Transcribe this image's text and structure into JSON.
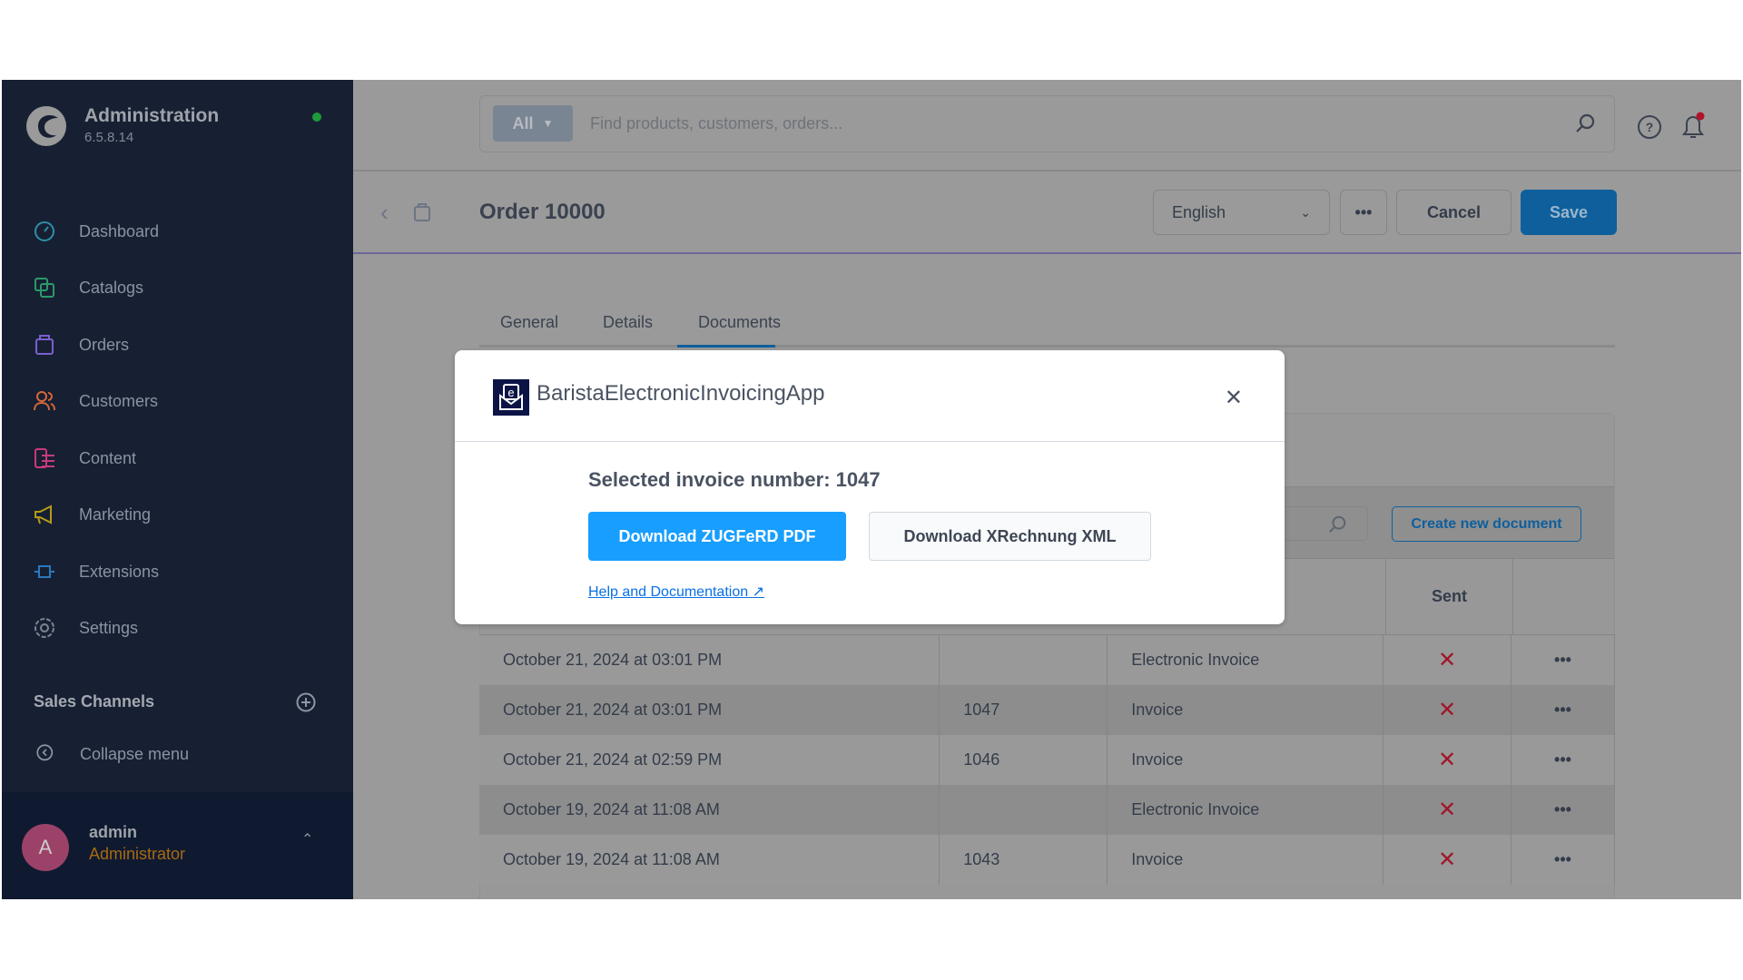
{
  "sidebar": {
    "app_title": "Administration",
    "version": "6.5.8.14",
    "status_color": "#1e9b3a",
    "items": [
      {
        "label": "Dashboard",
        "icon": "dashboard-icon",
        "color": "#2e8ea6"
      },
      {
        "label": "Catalogs",
        "icon": "catalog-icon",
        "color": "#2a9a6a"
      },
      {
        "label": "Orders",
        "icon": "orders-icon",
        "color": "#7a5fcf"
      },
      {
        "label": "Customers",
        "icon": "customers-icon",
        "color": "#d6663a"
      },
      {
        "label": "Content",
        "icon": "content-icon",
        "color": "#c83a7c"
      },
      {
        "label": "Marketing",
        "icon": "marketing-icon",
        "color": "#b79a18"
      },
      {
        "label": "Extensions",
        "icon": "extensions-icon",
        "color": "#2a79c0"
      },
      {
        "label": "Settings",
        "icon": "settings-icon",
        "color": "#7d8590"
      }
    ],
    "sales_channels": "Sales Channels",
    "collapse": "Collapse menu",
    "user": {
      "initial": "A",
      "name": "admin",
      "role": "Administrator"
    }
  },
  "topbar": {
    "filter": "All",
    "search_placeholder": "Find products, customers, orders..."
  },
  "header": {
    "title": "Order 10000",
    "language": "English",
    "cancel": "Cancel",
    "save": "Save"
  },
  "tabs": [
    "General",
    "Details",
    "Documents"
  ],
  "toolbar": {
    "create": "Create new document"
  },
  "table": {
    "headers": {
      "sent": "Sent"
    },
    "rows": [
      {
        "date": "October 21, 2024 at 03:01 PM",
        "number": "",
        "type": "Electronic Invoice",
        "sent": false
      },
      {
        "date": "October 21, 2024 at 03:01 PM",
        "number": "1047",
        "type": "Invoice",
        "sent": false
      },
      {
        "date": "October 21, 2024 at 02:59 PM",
        "number": "1046",
        "type": "Invoice",
        "sent": false
      },
      {
        "date": "October 19, 2024 at 11:08 AM",
        "number": "",
        "type": "Electronic Invoice",
        "sent": false
      },
      {
        "date": "October 19, 2024 at 11:08 AM",
        "number": "1043",
        "type": "Invoice",
        "sent": false
      }
    ]
  },
  "modal": {
    "title": "BaristaElectronicInvoicingApp",
    "invoice_label": "Selected invoice number: 1047",
    "zugferd": "Download ZUGFeRD PDF",
    "xrechnung": "Download XRechnung XML",
    "help": "Help and Documentation"
  }
}
